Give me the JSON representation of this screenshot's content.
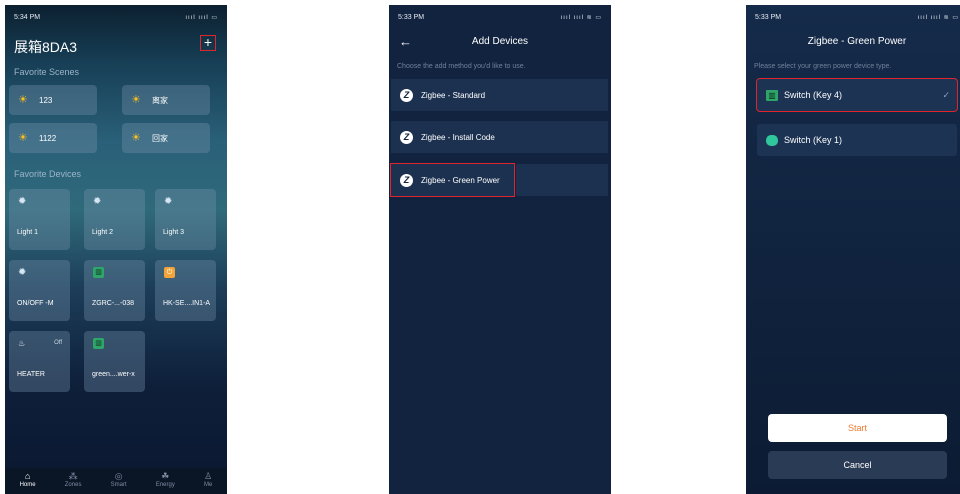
{
  "screen1": {
    "time": "5:34 PM",
    "status_icons": "ıııl ıııl ▭",
    "title": "展箱8DA3",
    "add_icon": "plus-icon",
    "favorite_scenes_label": "Favorite Scenes",
    "scenes": [
      {
        "label": "123",
        "icon": "sun-icon"
      },
      {
        "label": "离家",
        "icon": "sun-icon"
      },
      {
        "label": "1122",
        "icon": "sun-icon"
      },
      {
        "label": "回家",
        "icon": "sun-icon"
      }
    ],
    "favorite_devices_label": "Favorite Devices",
    "devices": [
      {
        "label": "Light 1",
        "icon": "bulb-icon",
        "state": ""
      },
      {
        "label": "Light 2",
        "icon": "bulb-icon",
        "state": ""
      },
      {
        "label": "Light 3",
        "icon": "bulb-icon",
        "state": ""
      },
      {
        "label": "ON/OFF -M",
        "icon": "bulb-icon",
        "state": ""
      },
      {
        "label": "ZGRC-...-038",
        "icon": "switch-icon",
        "state": ""
      },
      {
        "label": "HK-SE....IN1-A",
        "icon": "plug-icon",
        "state": ""
      },
      {
        "label": "HEATER",
        "icon": "heater-icon",
        "state": "Off"
      },
      {
        "label": "green....wer-x",
        "icon": "switch-icon",
        "state": ""
      }
    ],
    "tabs": [
      {
        "label": "Home",
        "icon": "home-icon"
      },
      {
        "label": "Zones",
        "icon": "zones-icon"
      },
      {
        "label": "Smart",
        "icon": "smart-icon"
      },
      {
        "label": "Energy",
        "icon": "energy-icon"
      },
      {
        "label": "Me",
        "icon": "person-icon"
      }
    ]
  },
  "screen2": {
    "time": "5:33 PM",
    "status_icons": "ıııl ıııl ≋ ▭",
    "title": "Add Devices",
    "hint": "Choose the add method you'd like to use.",
    "methods": [
      {
        "label": "Zigbee - Standard",
        "icon": "zigbee-icon"
      },
      {
        "label": "Zigbee - Install Code",
        "icon": "zigbee-icon"
      },
      {
        "label": "Zigbee - Green Power",
        "icon": "zigbee-icon"
      }
    ]
  },
  "screen3": {
    "time": "5:33 PM",
    "status_icons": "ıııl ıııl ≋ ▭",
    "title": "Zigbee - Green Power",
    "hint": "Please select your green power device type.",
    "options": [
      {
        "label": "Switch (Key 4)",
        "icon": "switch-icon",
        "selected": true
      },
      {
        "label": "Switch (Key 1)",
        "icon": "switch-key1-icon",
        "selected": false
      }
    ],
    "start_label": "Start",
    "cancel_label": "Cancel"
  },
  "colors": {
    "accent_orange": "#ee7a2f",
    "highlight_red": "#e0242b",
    "switch_green": "#2ea66a"
  }
}
